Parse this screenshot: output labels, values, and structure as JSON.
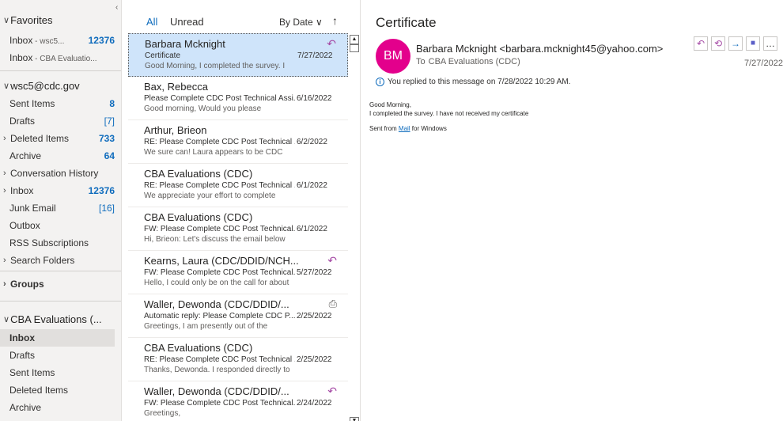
{
  "folders": {
    "favorites_label": "Favorites",
    "favorites": [
      {
        "label": "Inbox",
        "suffix": " - wsc5...",
        "count": "12376"
      },
      {
        "label": "Inbox",
        "suffix": " - CBA Evaluatio...",
        "count": ""
      }
    ],
    "account_label": "wsc5@cdc.gov",
    "account_items": [
      {
        "label": "Sent Items",
        "count": "8"
      },
      {
        "label": "Drafts",
        "count": "[7]"
      },
      {
        "label": "Deleted Items",
        "count": "733"
      },
      {
        "label": "Archive",
        "count": "64"
      },
      {
        "label": "Conversation History",
        "count": ""
      },
      {
        "label": "Inbox",
        "count": "12376"
      },
      {
        "label": "Junk Email",
        "count": "[16]"
      },
      {
        "label": "Outbox",
        "count": ""
      },
      {
        "label": "RSS Subscriptions",
        "count": ""
      },
      {
        "label": "Search Folders",
        "count": ""
      }
    ],
    "groups_label": "Groups",
    "shared_label": "CBA Evaluations (...",
    "shared_items": [
      {
        "label": "Inbox"
      },
      {
        "label": "Drafts"
      },
      {
        "label": "Sent Items"
      },
      {
        "label": "Deleted Items"
      },
      {
        "label": "Archive"
      }
    ]
  },
  "list": {
    "tab_all": "All",
    "tab_unread": "Unread",
    "sort_label": "By Date",
    "messages": [
      {
        "from": "Barbara Mcknight",
        "subject": "Certificate",
        "date": "7/27/2022",
        "preview": "Good Morning,  I completed the survey. I",
        "icon": "reply-icon"
      },
      {
        "from": "Bax, Rebecca",
        "subject": "Please Complete CDC Post Technical Assi...",
        "date": "6/16/2022",
        "preview": "Good morning,  Would you please",
        "icon": ""
      },
      {
        "from": "Arthur, Brieon",
        "subject": "RE: Please Complete CDC Post Technical ...",
        "date": "6/2/2022",
        "preview": "We sure can! Laura appears to be CDC",
        "icon": ""
      },
      {
        "from": "CBA Evaluations (CDC)",
        "subject": "RE: Please Complete CDC Post Technical ...",
        "date": "6/1/2022",
        "preview": "We appreciate your effort to complete",
        "icon": ""
      },
      {
        "from": "CBA Evaluations (CDC)",
        "subject": "FW: Please Complete CDC Post Technical...",
        "date": "6/1/2022",
        "preview": "Hi, Brieon:  Let's discuss the email below",
        "icon": ""
      },
      {
        "from": "Kearns, Laura (CDC/DDID/NCH...",
        "subject": "FW: Please Complete CDC Post Technical...",
        "date": "5/27/2022",
        "preview": "Hello, I could only be on the call for about",
        "icon": "reply-icon"
      },
      {
        "from": "Waller, Dewonda (CDC/DDID/...",
        "subject": "Automatic reply: Please Complete CDC P...",
        "date": "2/25/2022",
        "preview": "Greetings,   I am presently out of the",
        "icon": "auto-reply-icon"
      },
      {
        "from": "CBA Evaluations (CDC)",
        "subject": "RE: Please Complete CDC Post Technical ...",
        "date": "2/25/2022",
        "preview": "Thanks, Dewonda. I responded directly to",
        "icon": ""
      },
      {
        "from": "Waller, Dewonda (CDC/DDID/...",
        "subject": "FW: Please Complete CDC Post Technical...",
        "date": "2/24/2022",
        "preview": "Greetings,",
        "icon": "reply-icon"
      }
    ]
  },
  "reading": {
    "subject": "Certificate",
    "avatar_initials": "BM",
    "from": "Barbara Mcknight <barbara.mcknight45@yahoo.com>",
    "to_label": "To",
    "to": "CBA Evaluations (CDC)",
    "date": "7/27/2022",
    "info": "You replied to this message on 7/28/2022 10:29 AM.",
    "body_line1": "Good Morning,",
    "body_line2": "I completed the survey. I have not received my certificate",
    "sent_from_prefix": "Sent from ",
    "sent_from_link": "Mail",
    "sent_from_suffix": " for Windows"
  },
  "colors": {
    "accent": "#0f6cbd",
    "avatar": "#e3008c",
    "selected_row": "#cfe4fa",
    "reply_icon": "#a64ca6"
  }
}
